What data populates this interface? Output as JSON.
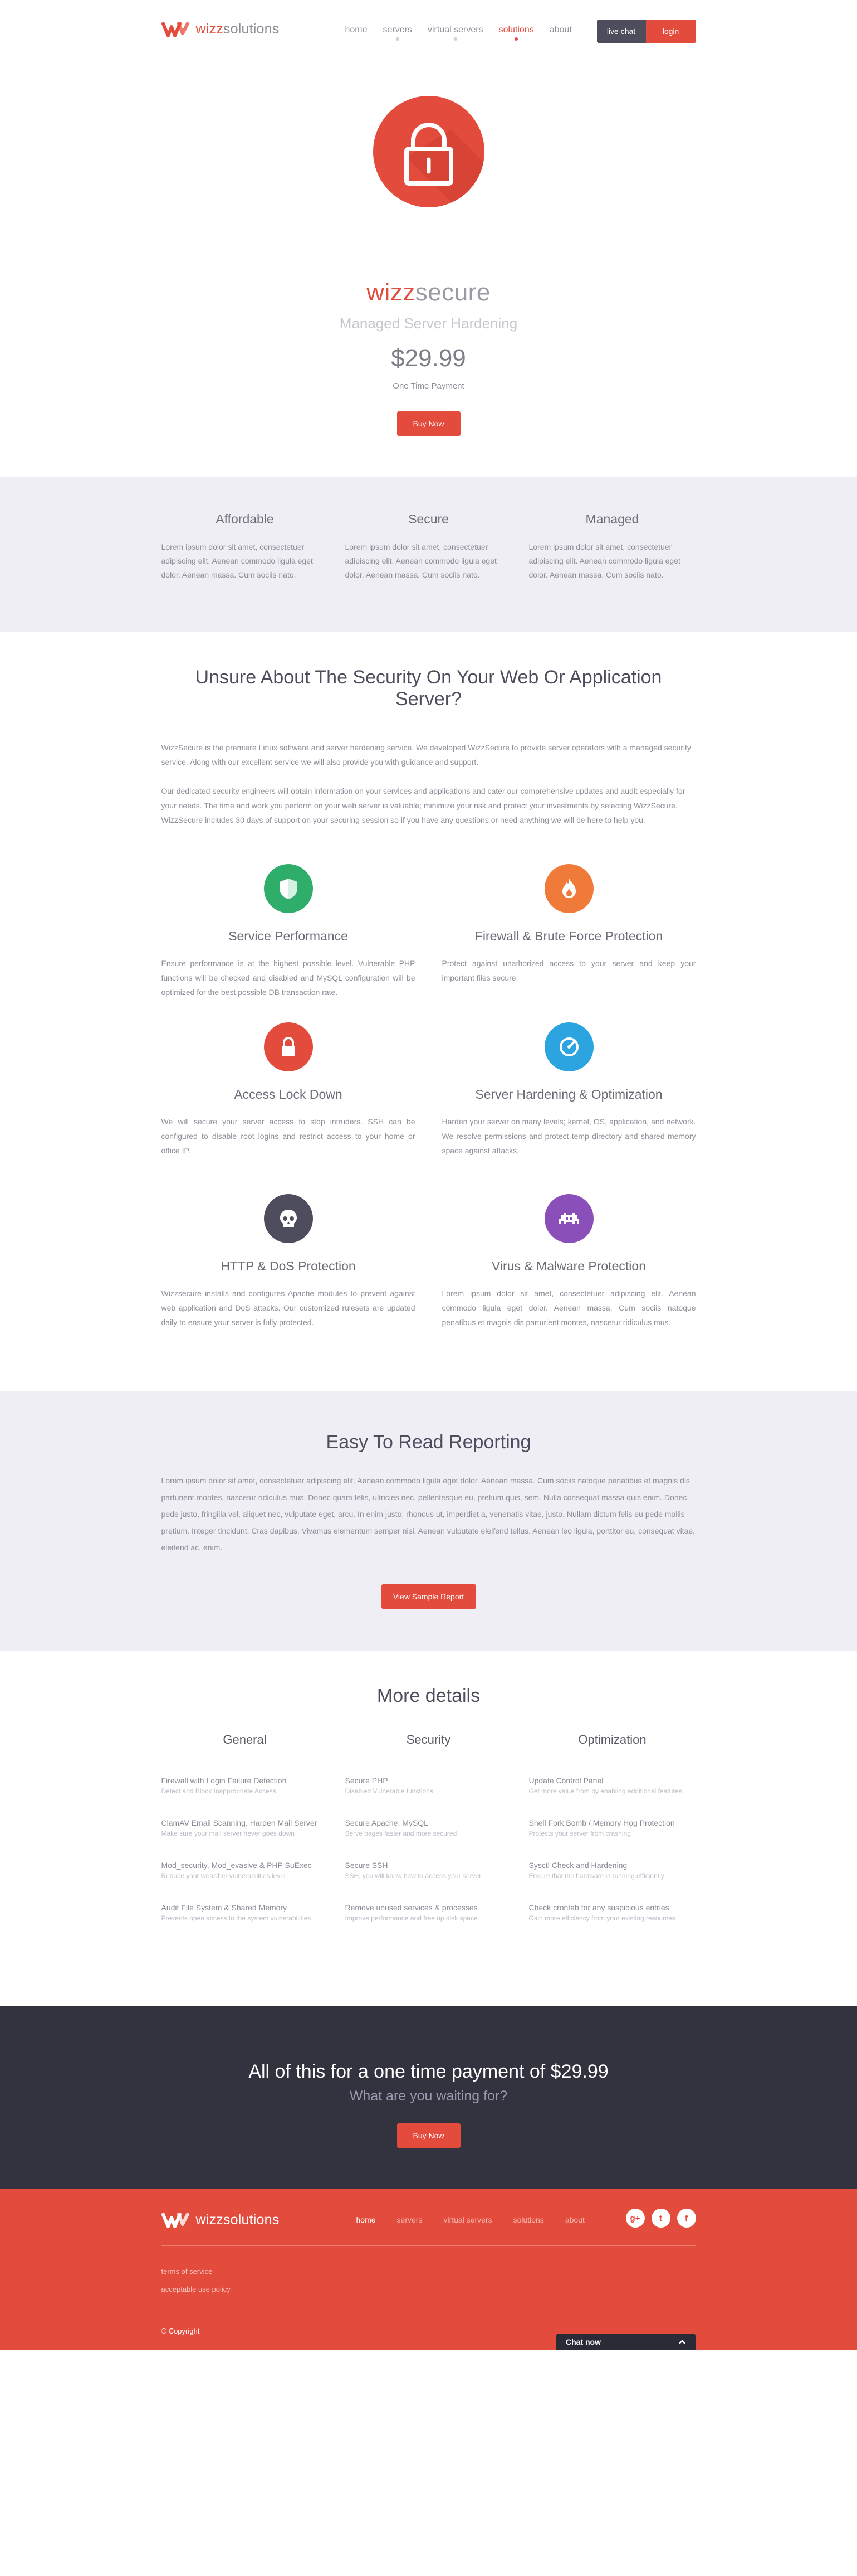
{
  "brand": {
    "logo_prefix": "wizz",
    "logo_suffix": "solutions"
  },
  "nav": {
    "items": [
      {
        "label": "home"
      },
      {
        "label": "servers"
      },
      {
        "label": "virtual servers"
      },
      {
        "label": "solutions"
      },
      {
        "label": "about"
      }
    ],
    "live_chat": "live chat",
    "login": "login"
  },
  "hero": {
    "product_prefix": "wizz",
    "product_suffix": "secure",
    "subtitle": "Managed Server Hardening",
    "price": "$29.99",
    "price_note": "One Time Payment",
    "buy_label": "Buy Now"
  },
  "strip": [
    {
      "title": "Affordable",
      "text": "Lorem ipsum dolor sit amet, consectetuer adipiscing elit. Aenean commodo ligula eget dolor. Aenean massa. Cum sociis nato."
    },
    {
      "title": "Secure",
      "text": "Lorem ipsum dolor sit amet, consectetuer adipiscing elit. Aenean commodo ligula eget dolor. Aenean massa. Cum sociis nato."
    },
    {
      "title": "Managed",
      "text": "Lorem ipsum dolor sit amet, consectetuer adipiscing elit. Aenean commodo ligula eget dolor. Aenean massa. Cum sociis nato."
    }
  ],
  "unsure": {
    "title": "Unsure About The Security On Your Web Or Application Server?",
    "p1": "WizzSecure is the premiere Linux software and server hardening service. We developed WizzSecure to provide server operators with a managed security service. Along with our excellent service we will also provide you with guidance and support.",
    "p2": "Our dedicated security engineers will obtain information on your services and applications and cater our comprehensive updates and audit especially for your needs. The time and work you perform on your web server is valuable; minimize your risk and protect your investments by selecting WizzSecure. WizzSecure includes 30 days of support on your securing session so if you have any questions or need anything we will be here to help you.",
    "features": [
      {
        "icon": "shield-icon",
        "color": "#2eae6a",
        "title": "Service Performance",
        "text": "Ensure performance is at the highest possible level. Vulnerable PHP functions will be checked and disabled and MySQL configuration will be optimized for the best possible DB transaction rate."
      },
      {
        "icon": "flame-icon",
        "color": "#f07a3a",
        "title": "Firewall & Brute Force Protection",
        "text": "Protect against unathorized access to your server and keep your important files secure."
      },
      {
        "icon": "lock-icon",
        "color": "#e34b3c",
        "title": "Access Lock Down",
        "text": "We will secure your server access to stop intruders. SSH can be configured to disable root logins and restrict access to your home or office IP."
      },
      {
        "icon": "gauge-icon",
        "color": "#2ba4e0",
        "title": "Server Hardening & Optimization",
        "text": "Harden your server on many levels; kernel, OS, application, and network. We resolve permissions and protect temp directory and shared memory space against attacks."
      },
      {
        "icon": "skull-icon",
        "color": "#4d4d5e",
        "title": "HTTP & DoS Protection",
        "text": "Wizzsecure installs and configures Apache modules to prevent against web application and DoS attacks. Our customized rulesets are updated daily to ensure your server is fully protected."
      },
      {
        "icon": "invader-icon",
        "color": "#8a4fb8",
        "title": "Virus & Malware Protection",
        "text": "Lorem ipsum dolor sit amet, consectetuer adipiscing elit. Aenean commodo ligula eget dolor. Aenean massa. Cum sociis natoque penatibus et magnis dis parturient montes, nascetur ridiculus mus."
      }
    ]
  },
  "report": {
    "title": "Easy To Read Reporting",
    "text": "Lorem ipsum dolor sit amet, consectetuer adipiscing elit. Aenean commodo ligula eget dolor. Aenean massa. Cum sociis natoque penatibus et magnis dis parturient montes, nascetur ridiculus mus. Donec quam felis, ultricies nec, pellentesque eu, pretium quis, sem. Nulla consequat massa quis enim. Donec pede justo, fringilla vel, aliquet nec, vulputate eget, arcu. In enim justo, rhoncus ut, imperdiet a, venenatis vitae, justo. Nullam dictum felis eu pede mollis pretium. Integer tincidunt. Cras dapibus. Vivamus elementum semper nisi. Aenean vulputate eleifend tellus. Aenean leo ligula, porttitor eu, consequat vitae, eleifend ac, enim.",
    "button": "View Sample Report"
  },
  "details": {
    "title": "More details",
    "columns": [
      {
        "heading": "General",
        "items": [
          {
            "t": "Firewall with Login Failure Detection",
            "d": "Detect and Block Inappropriate Access"
          },
          {
            "t": "ClamAV Email Scanning, Harden Mail Server",
            "d": "Make sure your mail server never goes down"
          },
          {
            "t": "Mod_security, Mod_evasive & PHP SuExec",
            "d": "Reduce your webs'ber vulnerabilities level"
          },
          {
            "t": "Audit File System & Shared Memory",
            "d": "Prevents open access to the system vulnerabilities"
          }
        ]
      },
      {
        "heading": "Security",
        "items": [
          {
            "t": "Secure PHP",
            "d": "Disabled Vulnerable functions"
          },
          {
            "t": "Secure Apache, MySQL",
            "d": "Serve pages faster and more secured"
          },
          {
            "t": "Secure SSH",
            "d": "SSH, you will know how to access your server"
          },
          {
            "t": "Remove unused services & processes",
            "d": "Improve performance and free up disk space"
          }
        ]
      },
      {
        "heading": "Optimization",
        "items": [
          {
            "t": "Update Control Panel",
            "d": "Get more value from by enabling additional features"
          },
          {
            "t": "Shell Fork Bomb / Memory Hog Protection",
            "d": "Protects your server from crashing"
          },
          {
            "t": "Sysctl Check and Hardening",
            "d": "Ensure that the hardware is running efficiently"
          },
          {
            "t": "Check crontab for any suspicious entries",
            "d": "Gain more efficiency from your existing resources"
          }
        ]
      }
    ]
  },
  "cta": {
    "line1": "All of this for a one time payment of $29.99",
    "line2": "What are you waiting for?",
    "button": "Buy Now"
  },
  "footer": {
    "nav": [
      {
        "label": "home"
      },
      {
        "label": "servers"
      },
      {
        "label": "virtual servers"
      },
      {
        "label": "solutions"
      },
      {
        "label": "about"
      }
    ],
    "social": [
      {
        "icon": "google-plus-icon",
        "glyph": "g+"
      },
      {
        "icon": "twitter-icon",
        "glyph": "t"
      },
      {
        "icon": "facebook-icon",
        "glyph": "f"
      }
    ],
    "links": [
      "terms of service",
      "acceptable use policy"
    ],
    "copyright": "© Copyright",
    "chat": "Chat now"
  },
  "colors": {
    "accent": "#e34b3c",
    "dark": "#33323f",
    "light_bg": "#eeeef4"
  }
}
